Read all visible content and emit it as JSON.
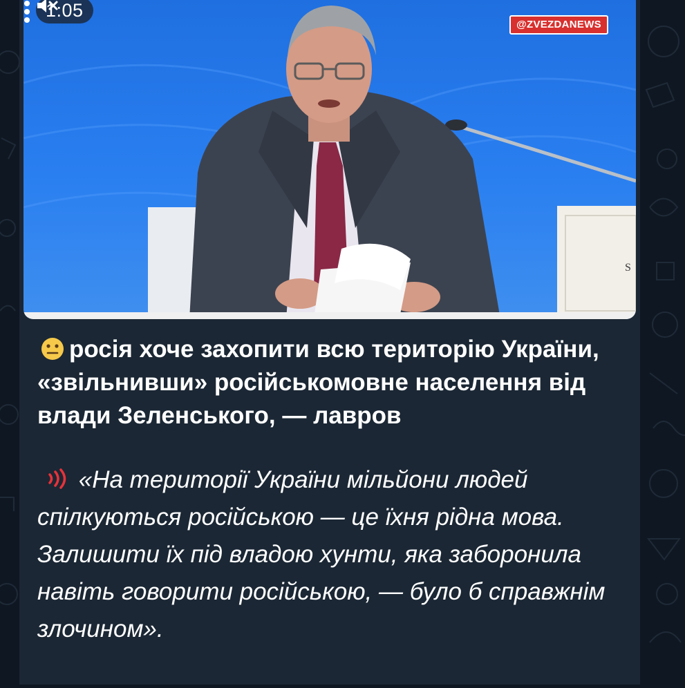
{
  "status": {
    "video_time": "1:05",
    "mute_icon": "speaker-muted-icon"
  },
  "video": {
    "watermark": "@ZVEZDANEWS",
    "more_icon": "vertical-dots-icon",
    "background_color": "#2a7ff0"
  },
  "message": {
    "headline_emoji": "neutral-face-emoji",
    "headline_text": "росія хоче захопити всю територію України, «звільнивши» російськомовне населення від влади Зеленського, — лавров",
    "quote_icon": "sound-waves-icon",
    "quote_text": "«На території України мільйони людей спілкуються російською — це їхня рідна мова. Залишити їх під владою хунти, яка заборонила навіть говорити російською, — було б справжнім злочином»."
  },
  "colors": {
    "chat_background": "#0f1722",
    "bubble_background": "#1b2734",
    "watermark_red": "#d8302e",
    "quote_icon_red": "#e8323a"
  }
}
